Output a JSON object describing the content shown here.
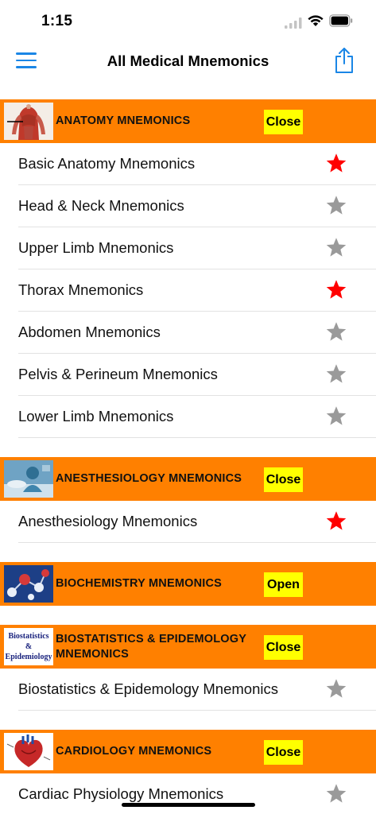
{
  "status": {
    "time": "1:15"
  },
  "nav": {
    "title": "All Medical Mnemonics",
    "menu_icon": "hamburger-menu-icon",
    "share_icon": "share-icon"
  },
  "colors": {
    "accent": "#1a86e6",
    "header_bg": "#ff8000",
    "button_bg": "#ffff00",
    "star_on": "#ff0000",
    "star_off": "#9a9a9a"
  },
  "sections": [
    {
      "title": "ANATOMY MNEMONICS",
      "button": "Close",
      "thumb": "anatomy-thumbnail",
      "items": [
        {
          "label": "Basic Anatomy Mnemonics",
          "favorite": true
        },
        {
          "label": "Head & Neck Mnemonics",
          "favorite": false
        },
        {
          "label": "Upper Limb Mnemonics",
          "favorite": false
        },
        {
          "label": "Thorax Mnemonics",
          "favorite": true
        },
        {
          "label": "Abdomen Mnemonics",
          "favorite": false
        },
        {
          "label": "Pelvis & Perineum Mnemonics",
          "favorite": false
        },
        {
          "label": "Lower Limb Mnemonics",
          "favorite": false
        }
      ]
    },
    {
      "title": "ANESTHESIOLOGY MNEMONICS",
      "button": "Close",
      "thumb": "anesthesiology-thumbnail",
      "items": [
        {
          "label": "Anesthesiology Mnemonics",
          "favorite": true
        }
      ]
    },
    {
      "title": "BIOCHEMISTRY MNEMONICS",
      "button": "Open",
      "thumb": "biochemistry-thumbnail",
      "items": []
    },
    {
      "title": "BIOSTATISTICS & EPIDEMOLOGY MNEMONICS",
      "button": "Close",
      "thumb": "biostatistics-thumbnail",
      "thumb_text": "Biostatistics & Epidemiology",
      "items": [
        {
          "label": "Biostatistics & Epidemology Mnemonics",
          "favorite": false
        }
      ]
    },
    {
      "title": "CARDIOLOGY MNEMONICS",
      "button": "Close",
      "thumb": "cardiology-thumbnail",
      "items": [
        {
          "label": "Cardiac Physiology Mnemonics",
          "favorite": false
        }
      ]
    }
  ]
}
